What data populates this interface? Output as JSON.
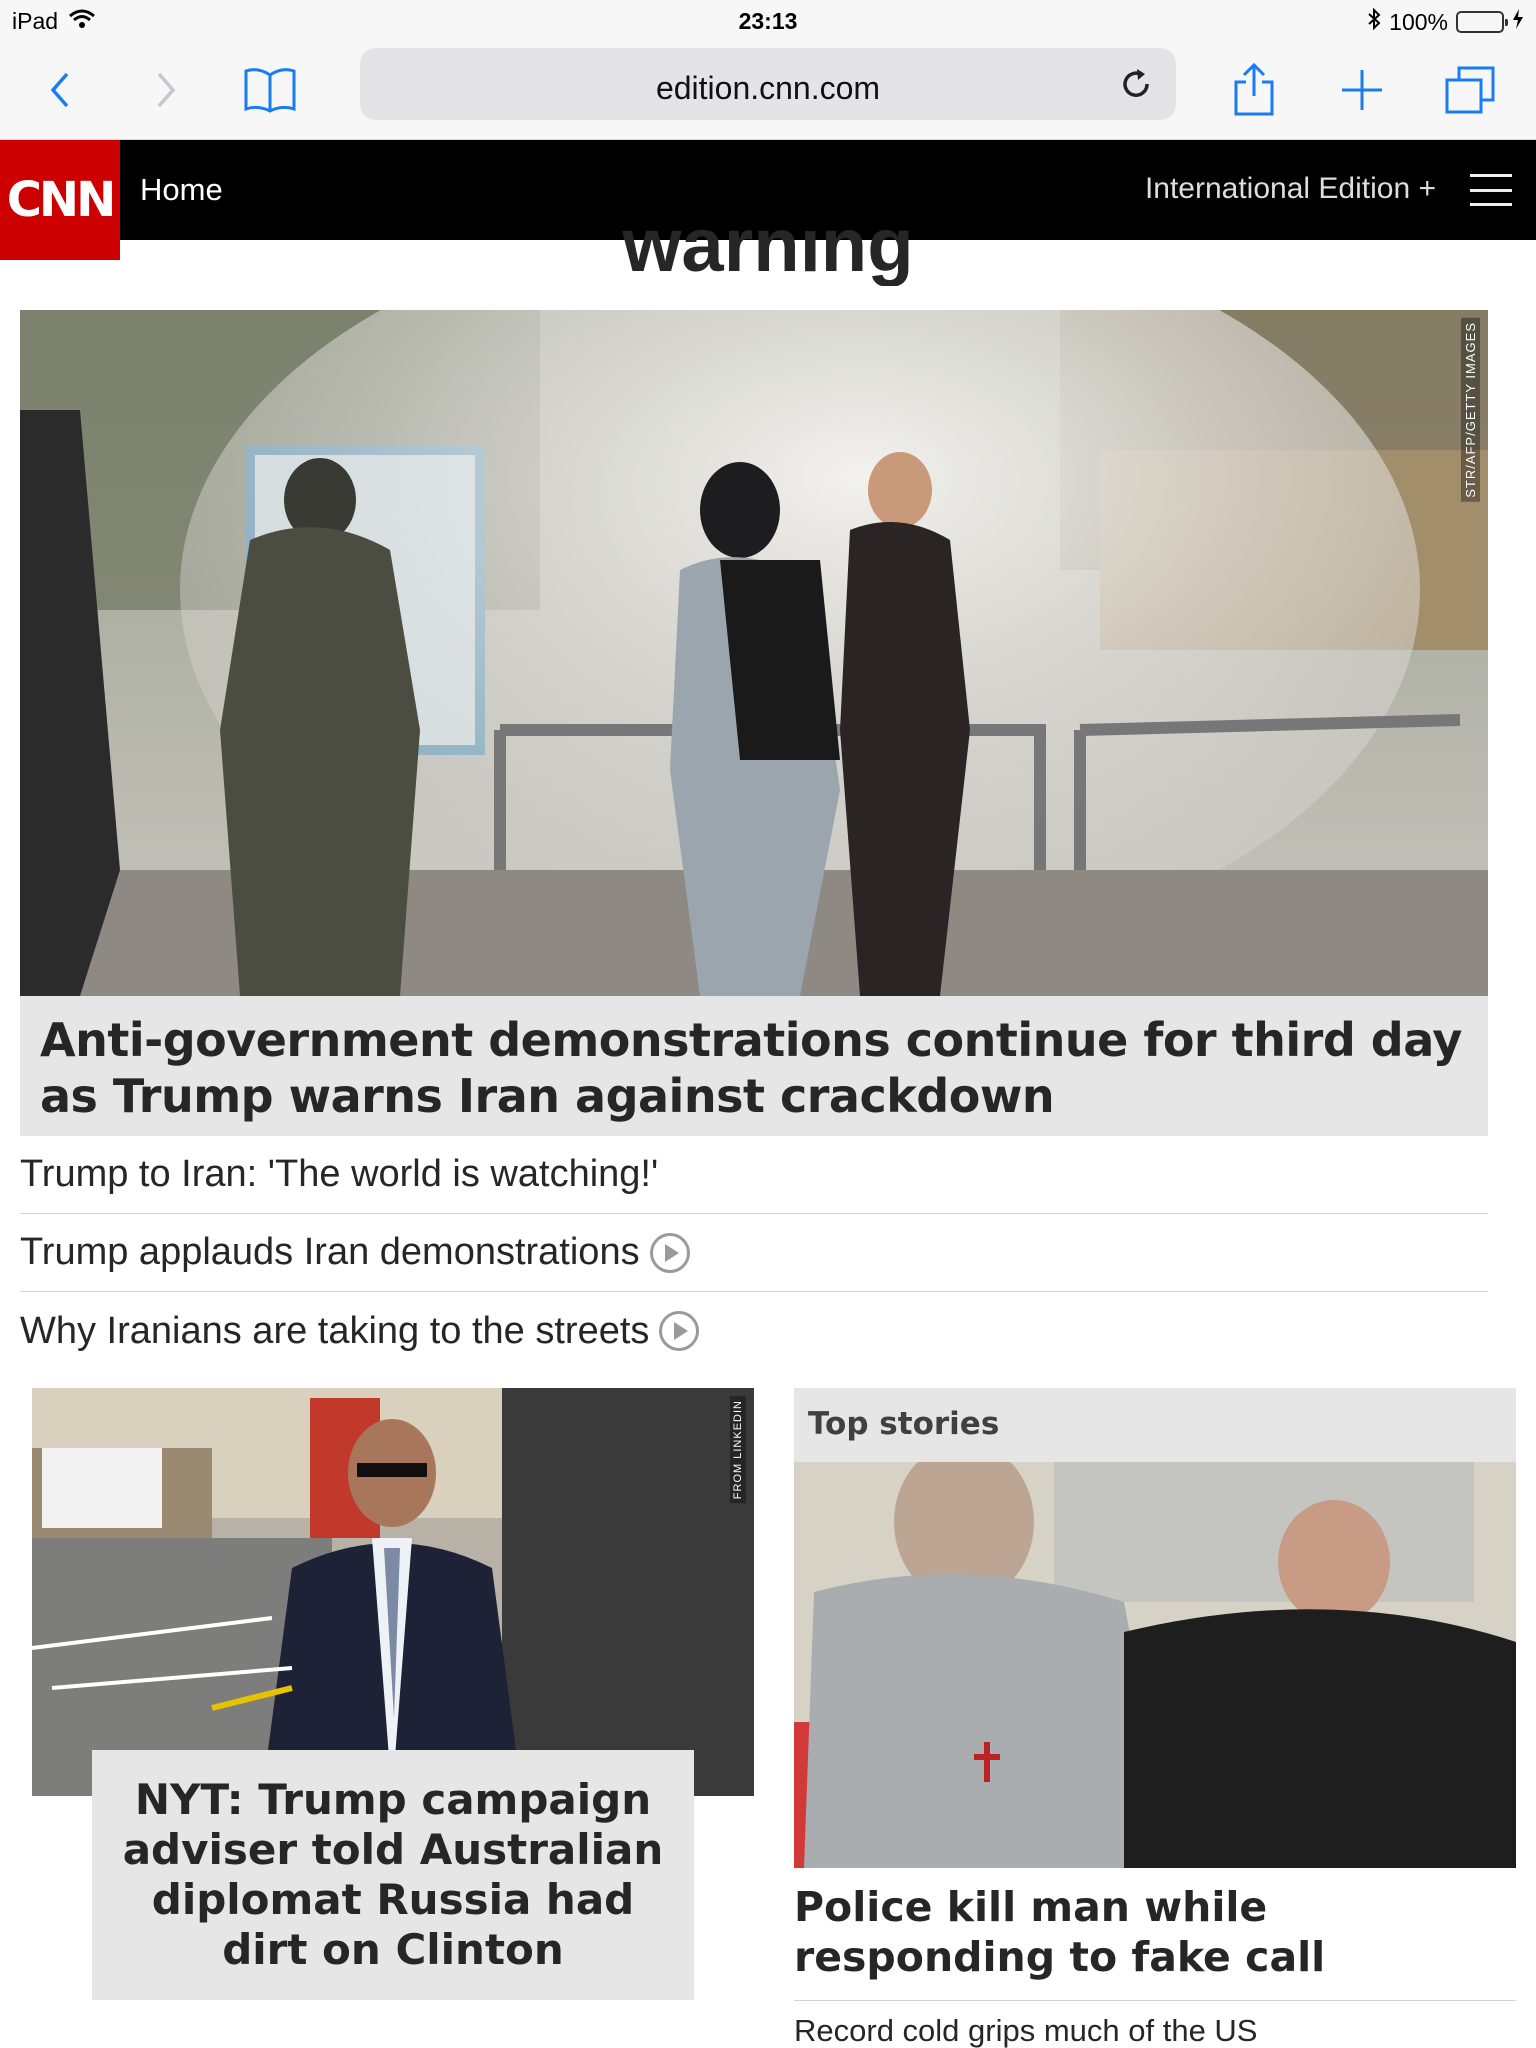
{
  "status_bar": {
    "device": "iPad",
    "time": "23:13",
    "battery_text": "100%",
    "battery_level": 1.0
  },
  "browser": {
    "url": "edition.cnn.com",
    "icons": [
      "back-icon",
      "forward-icon",
      "bookmarks-icon",
      "reload-icon",
      "share-icon",
      "new-tab-icon",
      "tabs-icon"
    ]
  },
  "header": {
    "logo_text": "CNN",
    "home_label": "Home",
    "edition_label": "International Edition +",
    "brand_color": "#cc0000"
  },
  "main": {
    "partial_title": "warning",
    "hero": {
      "photo_credit": "STR/AFP/GETTY IMAGES",
      "headline": "Anti-government demonstrations continue for third day as Trump warns Iran against crackdown"
    },
    "related_links": [
      {
        "text": "Trump to Iran: 'The world is watching!'",
        "video": false
      },
      {
        "text": "Trump applauds Iran demonstrations",
        "video": true
      },
      {
        "text": "Why Iranians are taking to the streets",
        "video": true
      }
    ],
    "left_card": {
      "photo_credit": "FROM LINKEDIN",
      "headline": "NYT: Trump campaign adviser told Australian diplomat Russia had dirt on Clinton"
    },
    "top_stories": {
      "header": "Top stories",
      "headline": "Police kill man while responding to fake call",
      "sub_link": "Record cold grips much of the US"
    }
  }
}
